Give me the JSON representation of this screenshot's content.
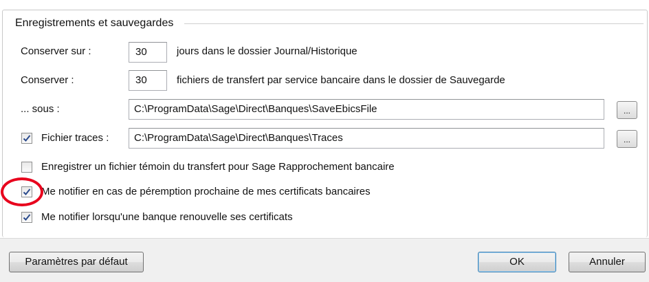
{
  "section": {
    "title": "Enregistrements et sauvegardes"
  },
  "retention_days": {
    "label": "Conserver sur :",
    "value": "30",
    "suffix": "jours dans le dossier Journal/Historique"
  },
  "retention_files": {
    "label": "Conserver :",
    "value": "30",
    "suffix": "fichiers de transfert par service bancaire dans le dossier de Sauvegarde"
  },
  "backup_path": {
    "label": "... sous :",
    "value": "C:\\ProgramData\\Sage\\Direct\\Banques\\SaveEbicsFile",
    "browse_label": "..."
  },
  "trace_file": {
    "label": "Fichier traces :",
    "checked": true,
    "value": "C:\\ProgramData\\Sage\\Direct\\Banques\\Traces",
    "browse_label": "..."
  },
  "options": [
    {
      "label": "Enregistrer un fichier témoin du transfert pour Sage Rapprochement bancaire",
      "checked": false
    },
    {
      "label": "Me notifier en cas de péremption prochaine de mes certificats bancaires",
      "checked": true
    },
    {
      "label": "Me notifier lorsqu'une banque renouvelle ses certificats",
      "checked": true
    }
  ],
  "footer": {
    "defaults_label": "Paramètres par défaut",
    "ok_label": "OK",
    "cancel_label": "Annuler"
  },
  "colors": {
    "annotation_circle": "#e8001c",
    "checkmark": "#2a4a8c"
  }
}
